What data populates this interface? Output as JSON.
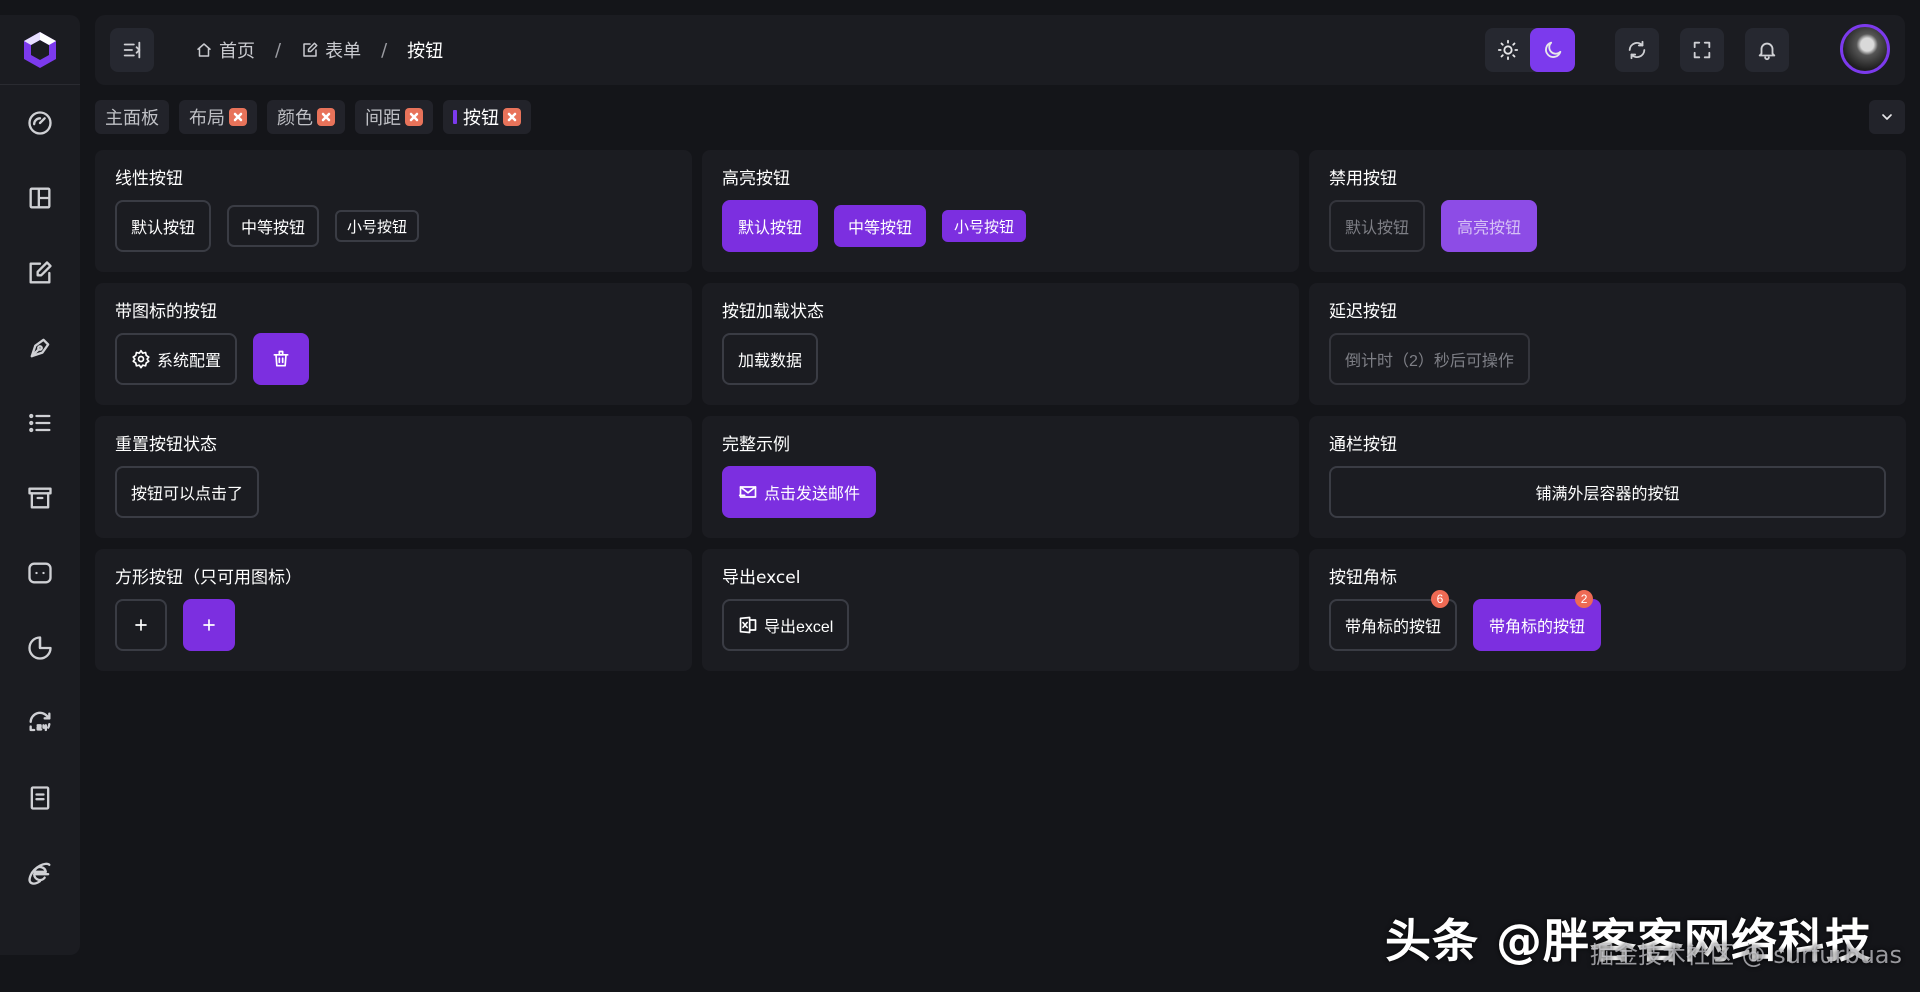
{
  "header": {
    "breadcrumb": [
      {
        "label": "首页",
        "icon": "home-icon"
      },
      {
        "label": "表单",
        "icon": "edit-icon"
      },
      {
        "label": "按钮"
      }
    ],
    "separator": "/"
  },
  "theme": {
    "active": "dark",
    "accent": "#7c3aed"
  },
  "tags": [
    {
      "label": "主面板",
      "closable": false
    },
    {
      "label": "布局",
      "closable": true
    },
    {
      "label": "颜色",
      "closable": true
    },
    {
      "label": "间距",
      "closable": true
    },
    {
      "label": "按钮",
      "closable": true,
      "active": true
    }
  ],
  "sidebar": {
    "icons": [
      "dashboard-icon",
      "layout-icon",
      "form-icon",
      "pen-icon",
      "list-icon",
      "archive-icon",
      "chat-icon",
      "pie-chart-icon",
      "history-24-icon",
      "document-icon",
      "ie-icon"
    ]
  },
  "cards": {
    "linear": {
      "title": "线性按钮",
      "buttons": [
        "默认按钮",
        "中等按钮",
        "小号按钮"
      ]
    },
    "highlight": {
      "title": "高亮按钮",
      "buttons": [
        "默认按钮",
        "中等按钮",
        "小号按钮"
      ]
    },
    "disabled": {
      "title": "禁用按钮",
      "buttons": [
        "默认按钮",
        "高亮按钮"
      ]
    },
    "icon": {
      "title": "带图标的按钮",
      "settings_label": "系统配置"
    },
    "loading": {
      "title": "按钮加载状态",
      "button": "加载数据"
    },
    "delay": {
      "title": "延迟按钮",
      "button": "倒计时（2）秒后可操作"
    },
    "reset": {
      "title": "重置按钮状态",
      "button": "按钮可以点击了"
    },
    "full": {
      "title": "完整示例",
      "button": "点击发送邮件"
    },
    "block": {
      "title": "通栏按钮",
      "button": "铺满外层容器的按钮"
    },
    "square": {
      "title": "方形按钮（只可用图标）"
    },
    "excel": {
      "title": "导出excel",
      "button": "导出excel"
    },
    "badge": {
      "title": "按钮角标",
      "buttons": [
        {
          "label": "带角标的按钮",
          "badge": "6"
        },
        {
          "label": "带角标的按钮",
          "badge": "2"
        }
      ]
    }
  },
  "watermark": {
    "main": "头条 @胖客客网络科技",
    "sub": "掘金技术社区 @ surfurbuas"
  }
}
